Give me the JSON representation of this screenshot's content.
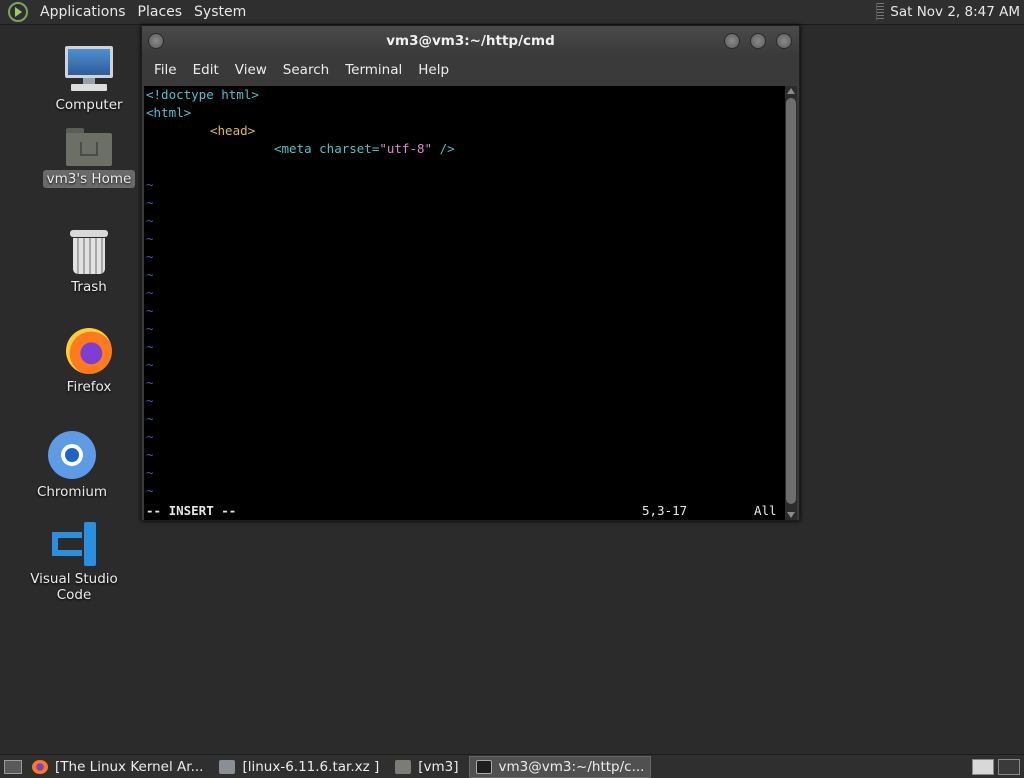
{
  "top_panel": {
    "menus": [
      "Applications",
      "Places",
      "System"
    ],
    "clock": "Sat Nov  2,  8:47 AM"
  },
  "desktop": {
    "icons": [
      {
        "label": "Computer",
        "icon": "computer-icon"
      },
      {
        "label": "vm3's Home",
        "icon": "home-folder-icon"
      },
      {
        "label": "Trash",
        "icon": "trash-icon"
      },
      {
        "label": "Firefox",
        "icon": "firefox-icon"
      },
      {
        "label": "Chromium",
        "icon": "chromium-icon"
      },
      {
        "label": "Visual Studio Code",
        "icon": "vscode-icon"
      }
    ]
  },
  "terminal": {
    "title": "vm3@vm3:~/http/cmd",
    "menus": [
      "File",
      "Edit",
      "View",
      "Search",
      "Terminal",
      "Help"
    ],
    "lines": {
      "l1": "<!doctype html>",
      "l2": "<html>",
      "l3": "<head>",
      "l4_open": "<meta charset=",
      "l4_str": "\"utf-8\"",
      "l4_close": " />"
    },
    "tilde": "~",
    "status": {
      "mode": "-- INSERT --",
      "position": "5,3-17",
      "percent": "All"
    }
  },
  "taskbar": {
    "tasks": [
      {
        "label": "[The Linux Kernel Ar...",
        "icon": "firefox-icon"
      },
      {
        "label": "[linux-6.11.6.tar.xz ]",
        "icon": "archive-icon"
      },
      {
        "label": "[vm3]",
        "icon": "folder-icon"
      },
      {
        "label": "vm3@vm3:~/http/c...",
        "icon": "terminal-icon"
      }
    ]
  }
}
